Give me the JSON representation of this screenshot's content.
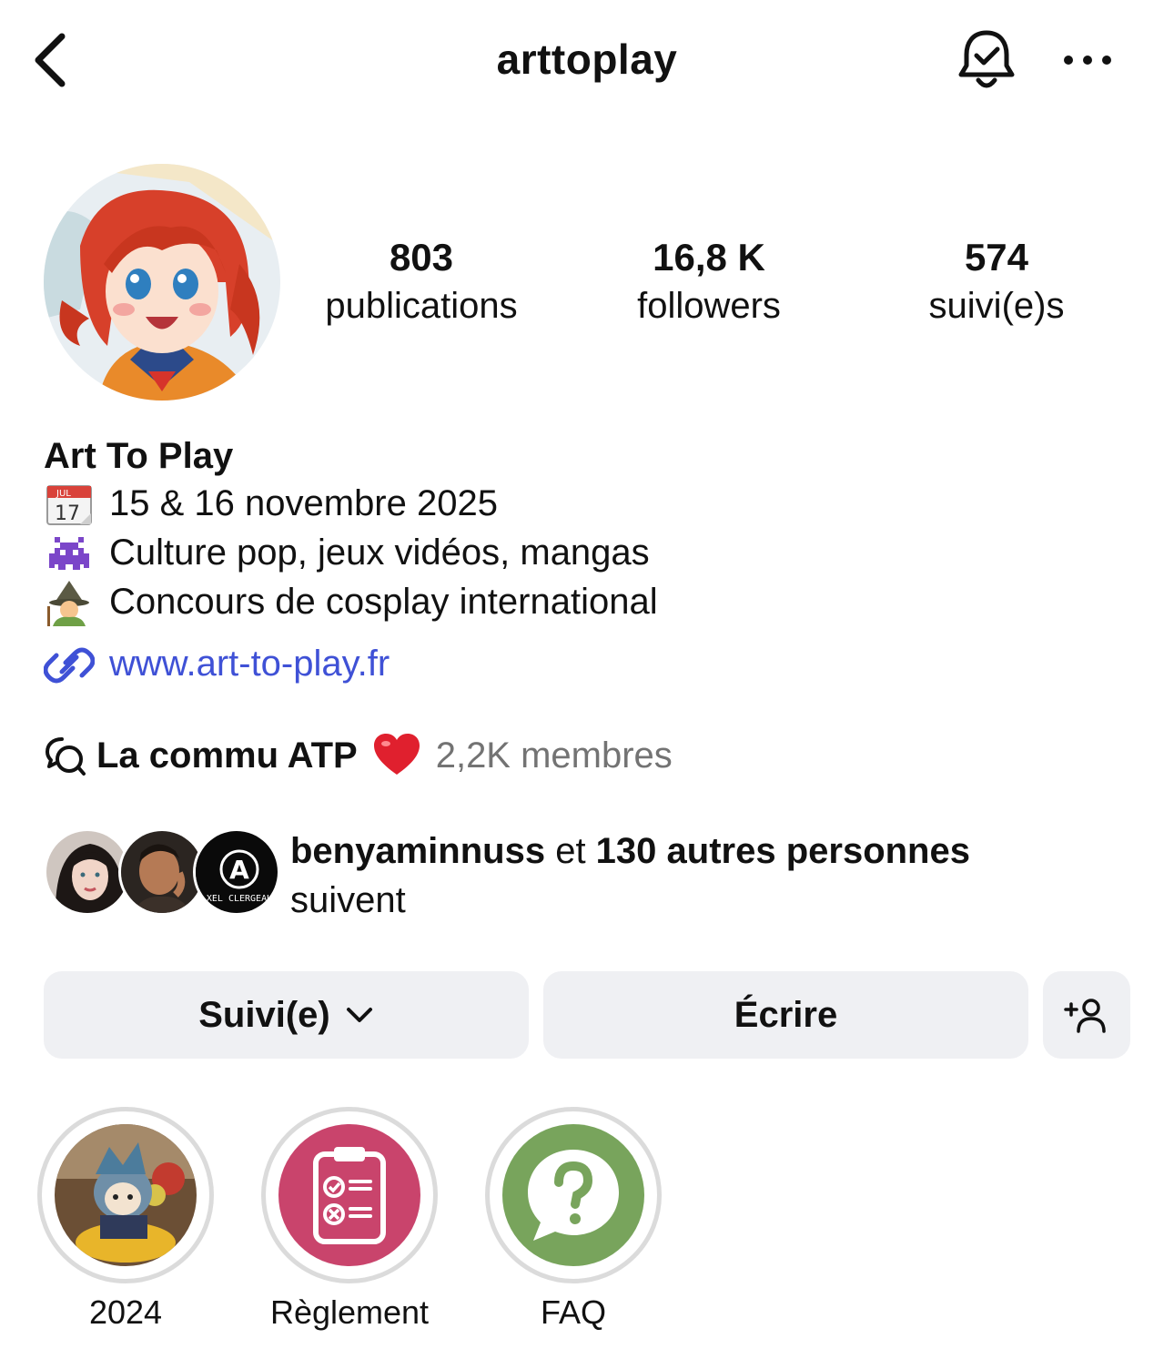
{
  "header": {
    "username": "arttoplay",
    "back_icon": "chevron-left-icon",
    "bell_icon": "bell-check-icon",
    "more_icon": "more-horizontal-icon"
  },
  "profile": {
    "avatar_icon": "profile-avatar",
    "stats": [
      {
        "value": "803",
        "label": "publications"
      },
      {
        "value": "16,8 K",
        "label": "followers"
      },
      {
        "value": "574",
        "label": "suivi(e)s"
      }
    ]
  },
  "bio": {
    "name": "Art To Play",
    "lines": [
      {
        "icon": "calendar-emoji",
        "text": "15 & 16 novembre 2025"
      },
      {
        "icon": "space-invader-emoji",
        "text": "Culture pop, jeux vidéos, mangas"
      },
      {
        "icon": "mage-emoji",
        "text": "Concours de cosplay international"
      }
    ],
    "calendar_emoji": {
      "month": "JUL",
      "day": "17"
    },
    "link": "www.art-to-play.fr",
    "link_color": "#3f51d6"
  },
  "community": {
    "name": "La commu ATP",
    "members": "2,2K membres",
    "heart_color": "#e0202e"
  },
  "followed_by": {
    "first_user": "benyaminnuss",
    "connector": " et ",
    "others": "130 autres personnes",
    "suffix": "suivent",
    "third_avatar_text": "XEL CLERGEAU",
    "third_avatar_mark": "A"
  },
  "actions": {
    "follow_label": "Suivi(e)",
    "message_label": "Écrire",
    "add_person_icon": "add-person-icon",
    "button_bg": "#eff0f3"
  },
  "highlights": [
    {
      "label": "2024",
      "color": "#8a6a3d"
    },
    {
      "label": "Règlement",
      "color": "#c9446c"
    },
    {
      "label": "FAQ",
      "color": "#78a45c"
    }
  ]
}
